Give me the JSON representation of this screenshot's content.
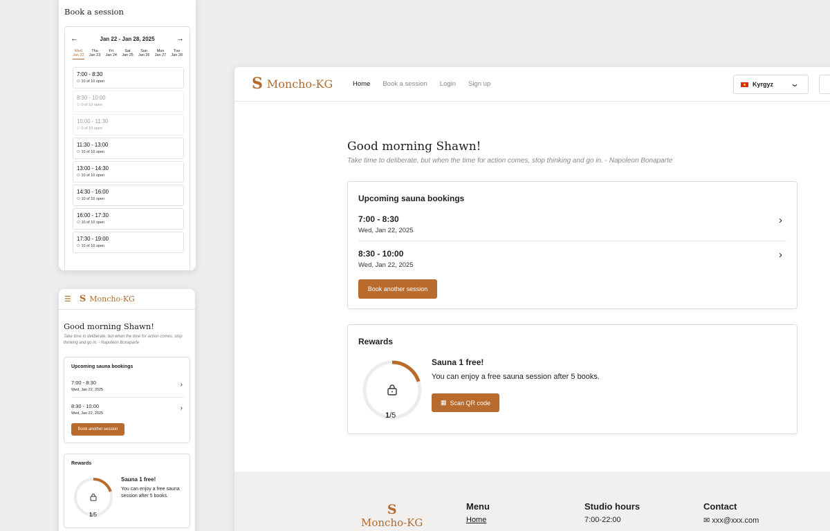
{
  "brand": {
    "mark": "S",
    "name": "Moncho-KG",
    "accent": "#b86b2d"
  },
  "booking": {
    "title": "Book a session",
    "week": "Jan 22 - Jan 28, 2025",
    "prev_icon": "←",
    "next_icon": "→",
    "days": [
      {
        "dow": "Wed",
        "date": "Jan 22"
      },
      {
        "dow": "Thu",
        "date": "Jan 23"
      },
      {
        "dow": "Fri",
        "date": "Jan 24"
      },
      {
        "dow": "Sat",
        "date": "Jan 25"
      },
      {
        "dow": "Sun",
        "date": "Jan 26"
      },
      {
        "dow": "Mon",
        "date": "Jan 27"
      },
      {
        "dow": "Tue",
        "date": "Jan 28"
      }
    ],
    "slots": [
      {
        "time": "7:00 - 8:30",
        "open": "10 of 10 open"
      },
      {
        "time": "8:30 - 10:00",
        "open": "0 of 10 open"
      },
      {
        "time": "10:00 - 11:30",
        "open": "0 of 10 open"
      },
      {
        "time": "11:30 - 13:00",
        "open": "10 of 10 open"
      },
      {
        "time": "13:00 - 14:30",
        "open": "10 of 10 open"
      },
      {
        "time": "14:30 - 16:00",
        "open": "10 of 10 open"
      },
      {
        "time": "16:00 - 17:30",
        "open": "10 of 10 open"
      },
      {
        "time": "17:30 - 19:00",
        "open": "10 of 10 open"
      }
    ]
  },
  "nav": {
    "links": [
      "Home",
      "Book a session",
      "Login",
      "Sign up"
    ],
    "language": "Kyrgyz"
  },
  "home": {
    "greeting": "Good morning Shawn!",
    "quote": "Take time to deliberate, but when the time for action comes, stop thinking and go in. - Napoleon Bonaparte",
    "mobile_quote": "Take time to deliberate, but when the time for action comes, stop thinking and go in. - Napoleon Bonaparte",
    "upcoming_title": "Upcoming sauna bookings",
    "bookings": [
      {
        "time": "7:00 - 8:30",
        "date": "Wed, Jan 22, 2025"
      },
      {
        "time": "8:30 - 10:00",
        "date": "Wed, Jan 22, 2025"
      }
    ],
    "book_another": "Book another session",
    "rewards_title": "Rewards",
    "reward_headline": "Sauna 1 free!",
    "reward_desc": "You can enjoy a free sauna session after 5 books.",
    "reward_desc_mobile": "You can enjoy a free sauna session after 5 books.",
    "scan_qr": "Scan QR code",
    "progress": {
      "current": "1",
      "total": "/5",
      "fraction": 0.2
    }
  },
  "footer": {
    "menu_title": "Menu",
    "menu_item": "Home",
    "hours_title": "Studio hours",
    "hours": "7:00-22:00",
    "contact_title": "Contact",
    "email": "xxx@xxx.com"
  }
}
